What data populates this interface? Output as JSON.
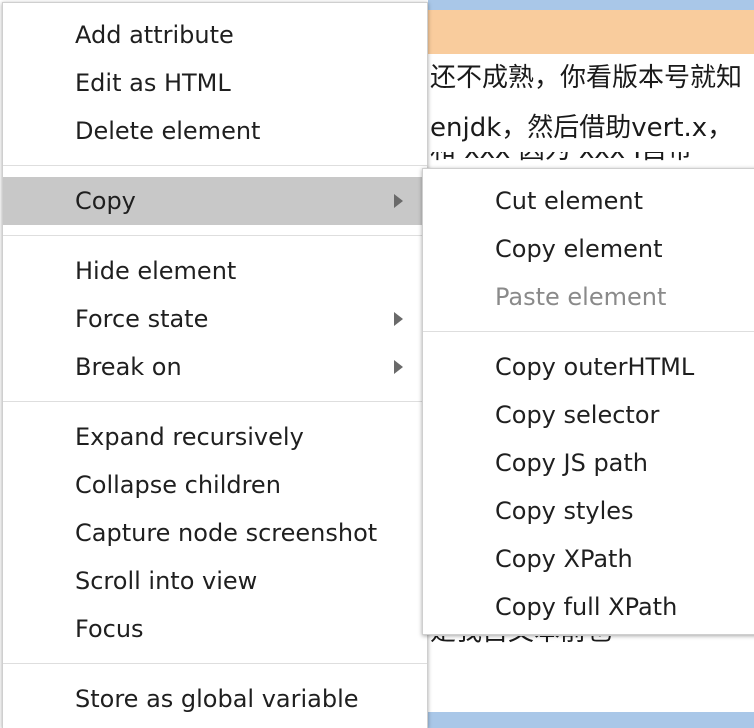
{
  "background": {
    "lines": [
      "还不成熟，你看版本号就知",
      "enjdk，然后借助vert.x，",
      "和 xxx 因为 xxx I自带",
      "是我自文本前也"
    ]
  },
  "main_menu": {
    "groups": [
      [
        {
          "label": "Add attribute",
          "submenu": false
        },
        {
          "label": "Edit as HTML",
          "submenu": false
        },
        {
          "label": "Delete element",
          "submenu": false
        }
      ],
      [
        {
          "label": "Copy",
          "submenu": true,
          "highlighted": true
        }
      ],
      [
        {
          "label": "Hide element",
          "submenu": false
        },
        {
          "label": "Force state",
          "submenu": true
        },
        {
          "label": "Break on",
          "submenu": true
        }
      ],
      [
        {
          "label": "Expand recursively",
          "submenu": false
        },
        {
          "label": "Collapse children",
          "submenu": false
        },
        {
          "label": "Capture node screenshot",
          "submenu": false
        },
        {
          "label": "Scroll into view",
          "submenu": false
        },
        {
          "label": "Focus",
          "submenu": false
        }
      ],
      [
        {
          "label": "Store as global variable",
          "submenu": false
        }
      ]
    ]
  },
  "copy_submenu": {
    "groups": [
      [
        {
          "label": "Cut element",
          "disabled": false
        },
        {
          "label": "Copy element",
          "disabled": false
        },
        {
          "label": "Paste element",
          "disabled": true
        }
      ],
      [
        {
          "label": "Copy outerHTML",
          "disabled": false
        },
        {
          "label": "Copy selector",
          "disabled": false
        },
        {
          "label": "Copy JS path",
          "disabled": false
        },
        {
          "label": "Copy styles",
          "disabled": false
        },
        {
          "label": "Copy XPath",
          "disabled": false
        },
        {
          "label": "Copy full XPath",
          "disabled": false
        }
      ]
    ]
  }
}
